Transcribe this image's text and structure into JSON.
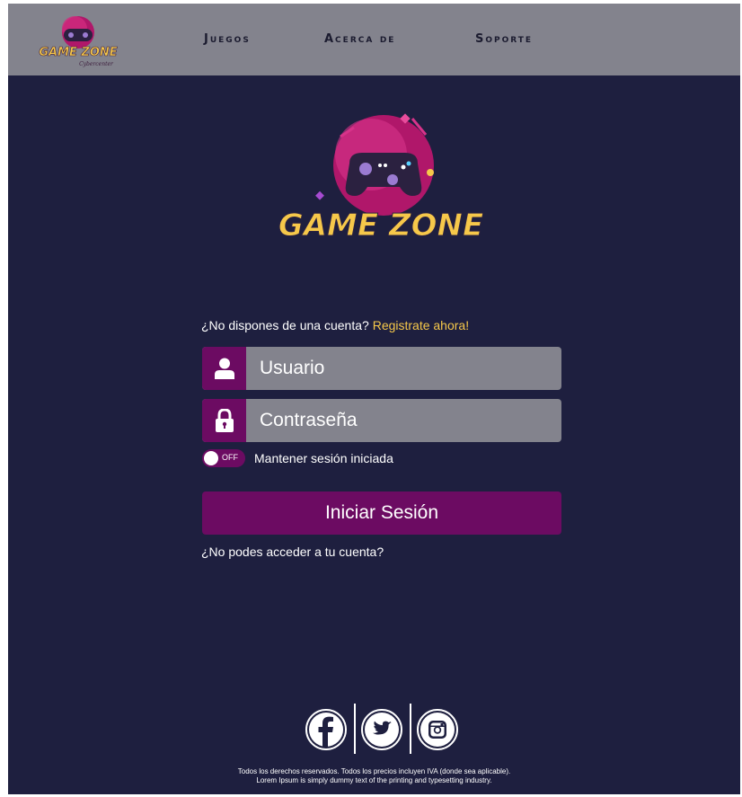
{
  "header": {
    "logo_text": "GAME ZONE",
    "logo_subtext": "Cybercenter",
    "nav": [
      "Juegos",
      "Acerca de",
      "Soporte"
    ]
  },
  "main_logo": {
    "text_line": "GAME ZONE"
  },
  "form": {
    "signup_prompt": "¿No dispones de una cuenta?",
    "signup_link": "Registrate ahora!",
    "username_placeholder": "Usuario",
    "password_placeholder": "Contraseña",
    "toggle_state": "OFF",
    "keep_session_label": "Mantener sesión iniciada",
    "login_button": "Iniciar Sesión",
    "forgot_link": "¿No podes acceder a tu cuenta?"
  },
  "footer": {
    "social": [
      "facebook-icon",
      "twitter-icon",
      "instagram-icon"
    ],
    "line1": "Todos los derechos reservados. Todos los precios incluyen IVA (donde sea aplicable).",
    "line2": "Lorem Ipsum is simply dummy text of the printing and typesetting industry."
  },
  "colors": {
    "background": "#1e1f3f",
    "header": "#83838d",
    "accent": "#6c0b62",
    "link": "#f6c84a",
    "logo_yellow": "#f6c84a",
    "logo_pink": "#c2185b"
  }
}
